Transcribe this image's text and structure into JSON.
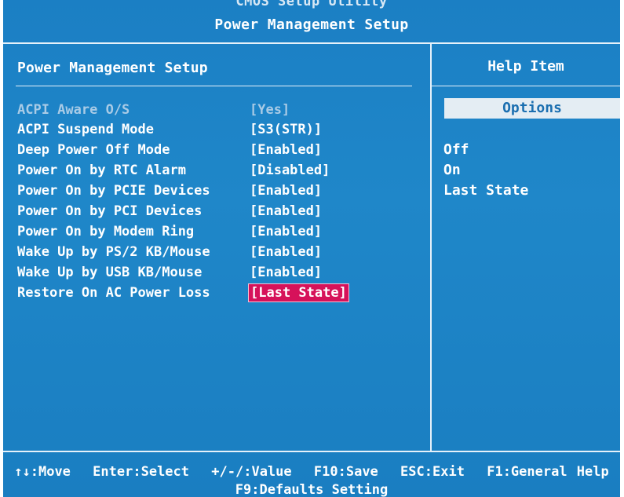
{
  "header": {
    "utility_title": "CMOS Setup Utility",
    "page_title": "Power Management Setup"
  },
  "left_panel": {
    "heading": "Power Management Setup",
    "settings": [
      {
        "label": "ACPI Aware O/S",
        "value": "[Yes]",
        "state": "disabled"
      },
      {
        "label": "ACPI Suspend Mode",
        "value": "[S3(STR)]",
        "state": "normal"
      },
      {
        "label": "Deep Power Off Mode",
        "value": "[Enabled]",
        "state": "normal"
      },
      {
        "label": "Power On by RTC Alarm",
        "value": "[Disabled]",
        "state": "normal"
      },
      {
        "label": "Power On by PCIE Devices",
        "value": "[Enabled]",
        "state": "normal"
      },
      {
        "label": "Power On by PCI Devices",
        "value": "[Enabled]",
        "state": "normal"
      },
      {
        "label": "Power On by Modem Ring",
        "value": "[Enabled]",
        "state": "normal"
      },
      {
        "label": "Wake Up by PS/2 KB/Mouse",
        "value": "[Enabled]",
        "state": "normal"
      },
      {
        "label": "Wake Up by USB KB/Mouse",
        "value": "[Enabled]",
        "state": "normal"
      },
      {
        "label": "Restore On AC Power Loss",
        "value": "[Last State]",
        "state": "selected"
      }
    ]
  },
  "right_panel": {
    "heading": "Help Item",
    "options_label": "Options",
    "options": [
      "Off",
      "On",
      "Last State"
    ]
  },
  "footer": {
    "keys": [
      {
        "key": "↑↓",
        "action": ":Move"
      },
      {
        "key": "Enter",
        "action": ":Select"
      },
      {
        "key": "+/-/",
        "action": ":Value"
      },
      {
        "key": "F10",
        "action": ":Save"
      },
      {
        "key": "ESC",
        "action": ":Exit"
      },
      {
        "key": "F1",
        "action": ":General Help"
      }
    ],
    "second_line": "F9:Defaults Setting"
  },
  "colors": {
    "background": "#1b7fc4",
    "selected_value": "#d6125a",
    "text": "#ffffff",
    "dim_text": "#a9cbe6"
  }
}
